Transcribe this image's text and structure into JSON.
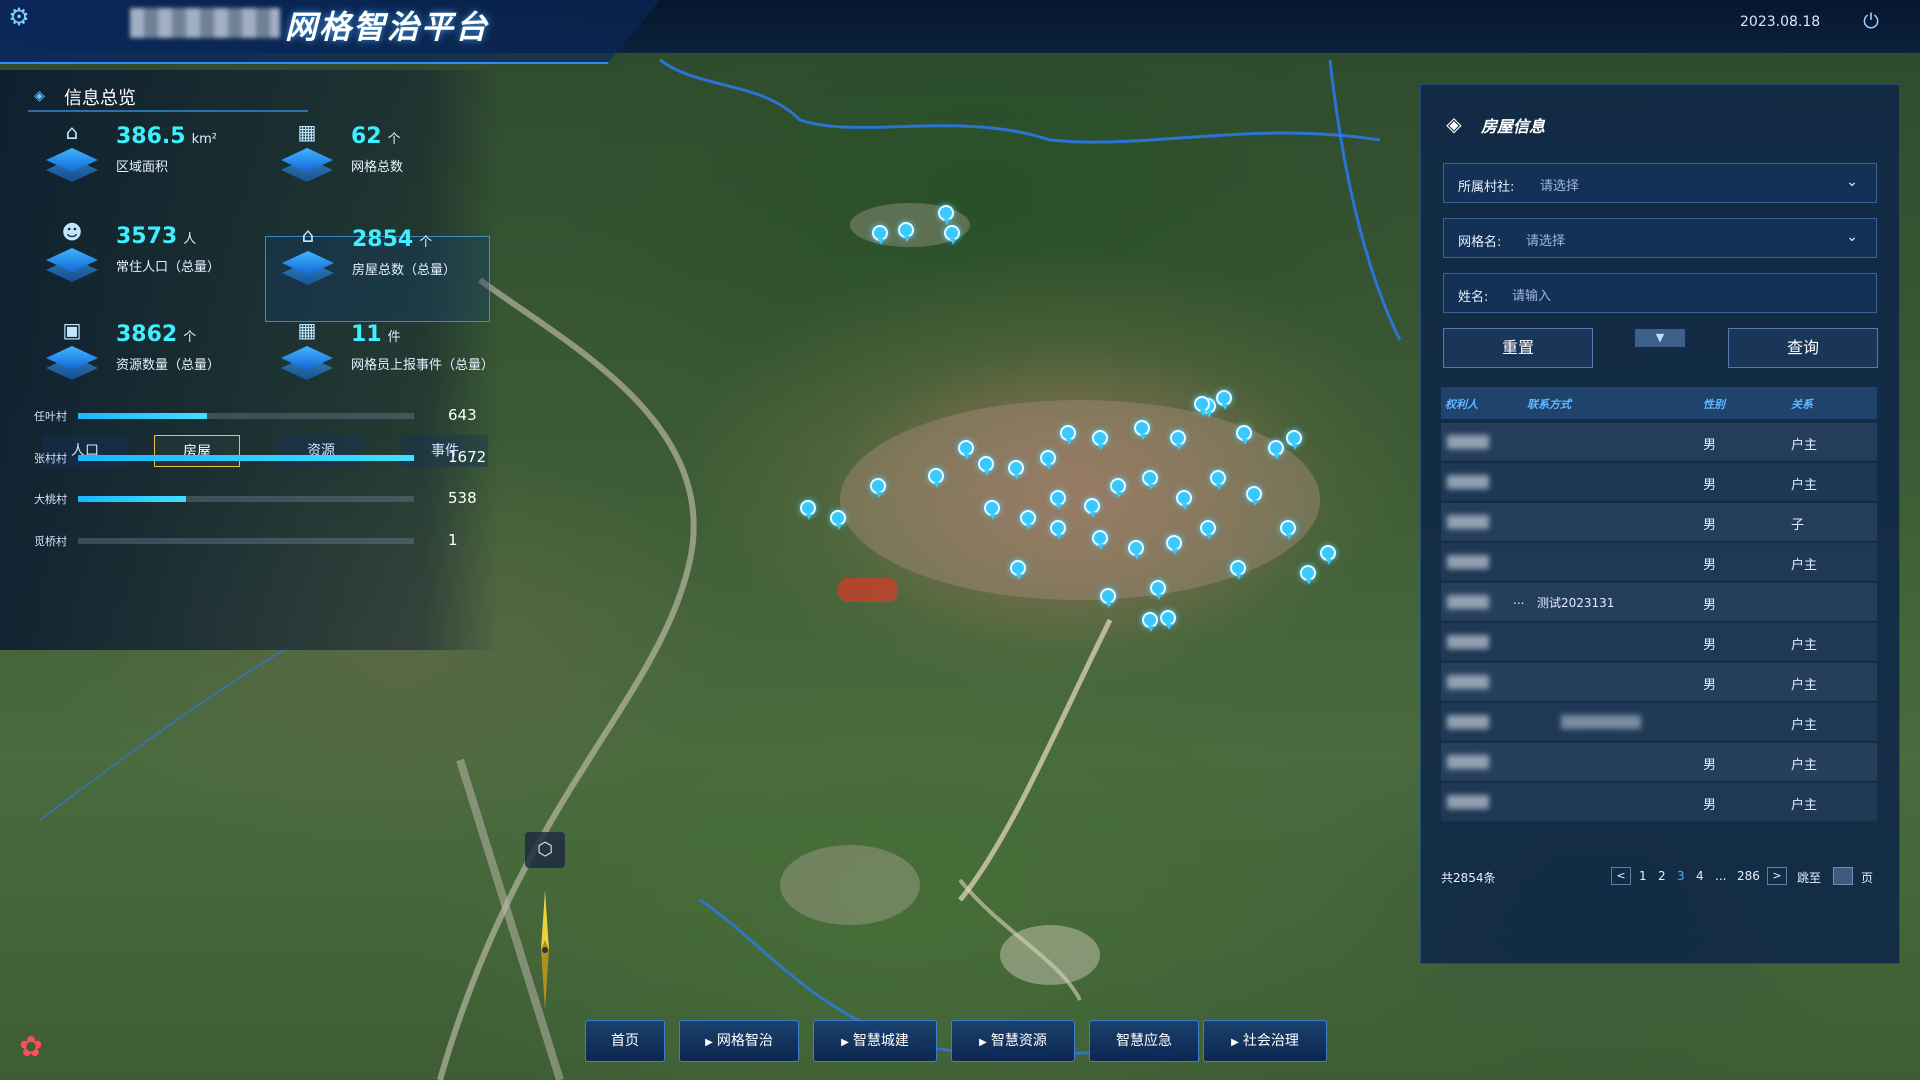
{
  "header": {
    "title": "网格智治平台",
    "date": "2023.08.18"
  },
  "overview": {
    "title": "信息总览",
    "stats": [
      {
        "value": "386.5",
        "unit": "km²",
        "label": "区域面积",
        "icon": "building-icon"
      },
      {
        "value": "62",
        "unit": "个",
        "label": "网格总数",
        "icon": "grid-icon"
      },
      {
        "value": "3573",
        "unit": "人",
        "label": "常住人口（总量）",
        "icon": "person-icon"
      },
      {
        "value": "2854",
        "unit": "个",
        "label": "房屋总数（总量）",
        "icon": "house-icon"
      },
      {
        "value": "3862",
        "unit": "个",
        "label": "资源数量（总量）",
        "icon": "resource-icon"
      },
      {
        "value": "11",
        "unit": "件",
        "label": "网格员上报事件（总量）",
        "icon": "event-icon"
      }
    ],
    "tabs": [
      "人口",
      "房屋",
      "资源",
      "事件"
    ],
    "active_tab": "房屋",
    "bars": [
      {
        "name": "任叶村",
        "value": 643
      },
      {
        "name": "张村村",
        "value": 1672
      },
      {
        "name": "大桃村",
        "value": 538
      },
      {
        "name": "觅桥村",
        "value": 1
      }
    ],
    "bar_max": 1672
  },
  "house_info": {
    "title": "房屋信息",
    "village": {
      "label": "所属村社:",
      "placeholder": "请选择"
    },
    "grid": {
      "label": "网格名:",
      "placeholder": "请选择"
    },
    "name": {
      "label": "姓名:",
      "placeholder": "请输入"
    },
    "reset_label": "重置",
    "query_label": "查询",
    "columns": [
      "权利人",
      "联系方式",
      "性别",
      "关系"
    ],
    "rows": [
      {
        "contact": "",
        "gender": "男",
        "relation": "户主"
      },
      {
        "contact": "",
        "gender": "男",
        "relation": "户主"
      },
      {
        "contact": "",
        "gender": "男",
        "relation": "子"
      },
      {
        "contact": "",
        "gender": "男",
        "relation": "户主"
      },
      {
        "contact": "测试2023131",
        "gender": "男",
        "relation": ""
      },
      {
        "contact": "",
        "gender": "男",
        "relation": "户主"
      },
      {
        "contact": "",
        "gender": "男",
        "relation": "户主"
      },
      {
        "contact": "",
        "gender": "",
        "relation": "户主"
      },
      {
        "contact": "",
        "gender": "男",
        "relation": "户主"
      },
      {
        "contact": "",
        "gender": "男",
        "relation": "户主"
      }
    ],
    "pagination": {
      "total": "共2854条",
      "prev": "<",
      "next": ">",
      "pages": [
        "1",
        "2",
        "3",
        "4",
        "...",
        "286"
      ],
      "current": "3",
      "jump_label": "跳至",
      "page_suffix": "页"
    }
  },
  "nav": [
    "首页",
    "网格智治",
    "智慧城建",
    "智慧资源",
    "智慧应急",
    "社会治理"
  ],
  "nav_arrows": [
    false,
    true,
    true,
    true,
    false,
    true
  ]
}
